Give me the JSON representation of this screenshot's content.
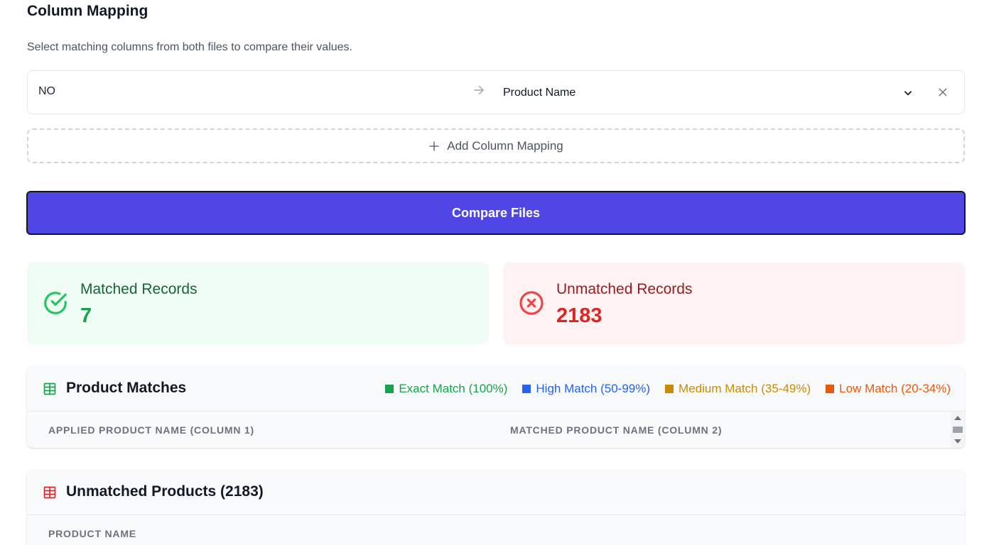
{
  "column_mapping": {
    "title": "Column Mapping",
    "description": "Select matching columns from both files to compare their values.",
    "rows": [
      {
        "source_column": "NO",
        "target_column": "Product Name"
      }
    ],
    "add_label": "Add Column Mapping"
  },
  "compare_button": {
    "label": "Compare Files"
  },
  "stats": {
    "matched": {
      "label": "Matched Records",
      "value": "7"
    },
    "unmatched": {
      "label": "Unmatched Records",
      "value": "2183"
    }
  },
  "product_matches": {
    "title": "Product Matches",
    "legend": [
      {
        "label": "Exact Match (100%)",
        "color": "#16a34a"
      },
      {
        "label": "High Match (50-99%)",
        "color": "#2563eb"
      },
      {
        "label": "Medium Match (35-49%)",
        "color": "#ca8a04"
      },
      {
        "label": "Low Match (20-34%)",
        "color": "#ea580c"
      }
    ],
    "columns": [
      "APPLIED PRODUCT NAME (COLUMN 1)",
      "MATCHED PRODUCT NAME (COLUMN 2)"
    ]
  },
  "unmatched_products": {
    "title": "Unmatched Products (2183)",
    "columns": [
      "PRODUCT NAME"
    ]
  },
  "colors": {
    "primary": "#4f46e5",
    "success": "#16a34a",
    "danger": "#dc2626"
  }
}
